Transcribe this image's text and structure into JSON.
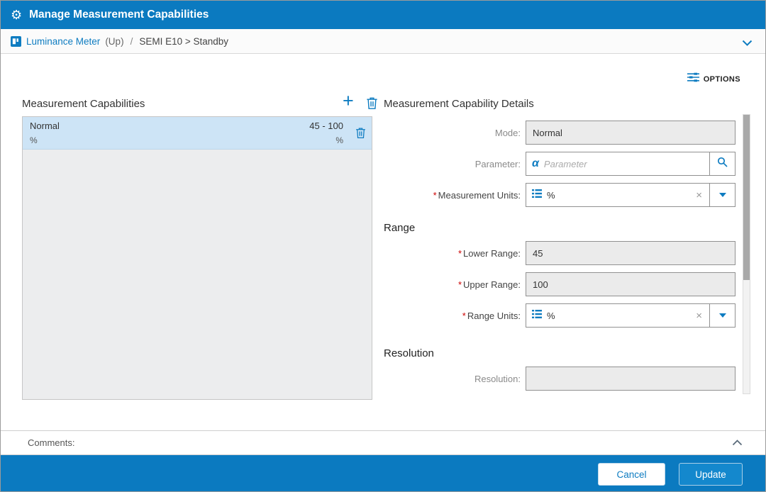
{
  "colors": {
    "primary": "#0b7ac0",
    "link": "#0e7cc1",
    "selected_row": "#cde4f6",
    "required_red": "#cc0000"
  },
  "header": {
    "title": "Manage Measurement Capabilities"
  },
  "breadcrumb": {
    "device_label": "Luminance Meter",
    "up_label": "(Up)",
    "separator": "/",
    "path_label": "SEMI E10 > Standby"
  },
  "options": {
    "label": "OPTIONS"
  },
  "capabilities_panel": {
    "title": "Measurement Capabilities",
    "items": [
      {
        "name": "Normal",
        "range": "45 - 100",
        "name_units": "%",
        "range_units": "%",
        "selected": true
      }
    ]
  },
  "details": {
    "title": "Measurement Capability Details",
    "mode_label": "Mode:",
    "mode_value": "Normal",
    "parameter_label": "Parameter:",
    "parameter_placeholder": "Parameter",
    "measurement_units_label": "Measurement Units:",
    "measurement_units_value": "%",
    "range_heading": "Range",
    "lower_range_label": "Lower Range:",
    "lower_range_value": "45",
    "upper_range_label": "Upper Range:",
    "upper_range_value": "100",
    "range_units_label": "Range Units:",
    "range_units_value": "%",
    "resolution_heading": "Resolution",
    "resolution_label": "Resolution:",
    "resolution_value": ""
  },
  "comments": {
    "label": "Comments:"
  },
  "footer": {
    "cancel_label": "Cancel",
    "update_label": "Update"
  },
  "icons": {
    "gear": "⚙",
    "plus": "+",
    "clear": "×",
    "alpha": "α"
  },
  "ui": {
    "required_marker": "*"
  }
}
